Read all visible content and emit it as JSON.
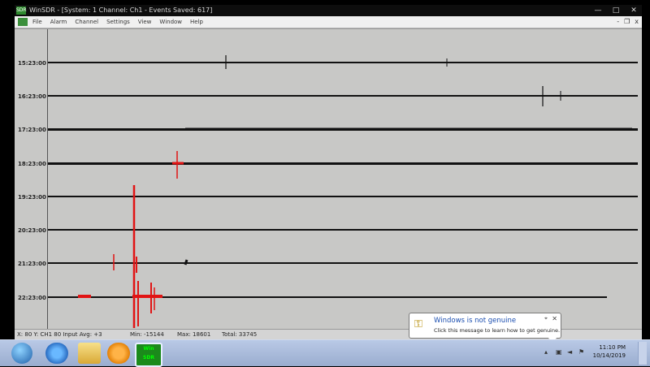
{
  "window": {
    "title": "WinSDR - [System: 1 Channel: Ch1 - Events Saved: 617]",
    "app_icon_label": "SDR",
    "controls": {
      "minimize": "—",
      "maximize": "□",
      "close": "✕"
    }
  },
  "menu": {
    "items": [
      "File",
      "Alarm",
      "Channel",
      "Settings",
      "View",
      "Window",
      "Help"
    ],
    "mdi_controls": {
      "minimize": "-",
      "restore": "❐",
      "close": "x"
    }
  },
  "rows": [
    {
      "label": "15:23:00"
    },
    {
      "label": "16:23:00"
    },
    {
      "label": "17:23:00"
    },
    {
      "label": "18:23:00"
    },
    {
      "label": "19:23:00"
    },
    {
      "label": "20:23:00"
    },
    {
      "label": "21:23:00"
    },
    {
      "label": "22:23:00"
    }
  ],
  "status": {
    "left": "X: 80  Y: CH1  80  Input Avg: +3",
    "min": "Min: -15144",
    "max": "Max: 18601",
    "total": "Total: 33745"
  },
  "balloon": {
    "title": "Windows is not genuine",
    "message": "Click this message to learn how to get genuine.",
    "close": "✕",
    "options": "⌖"
  },
  "taskbar": {
    "winsdr_label_top": "Win",
    "winsdr_label_bottom": "SDR",
    "time": "11:10 PM",
    "date": "10/14/2019"
  },
  "colors": {
    "trace": "#111111",
    "event": "#e11414",
    "plot_bg": "#c8c8c6",
    "balloon_title": "#1c4fb0"
  }
}
